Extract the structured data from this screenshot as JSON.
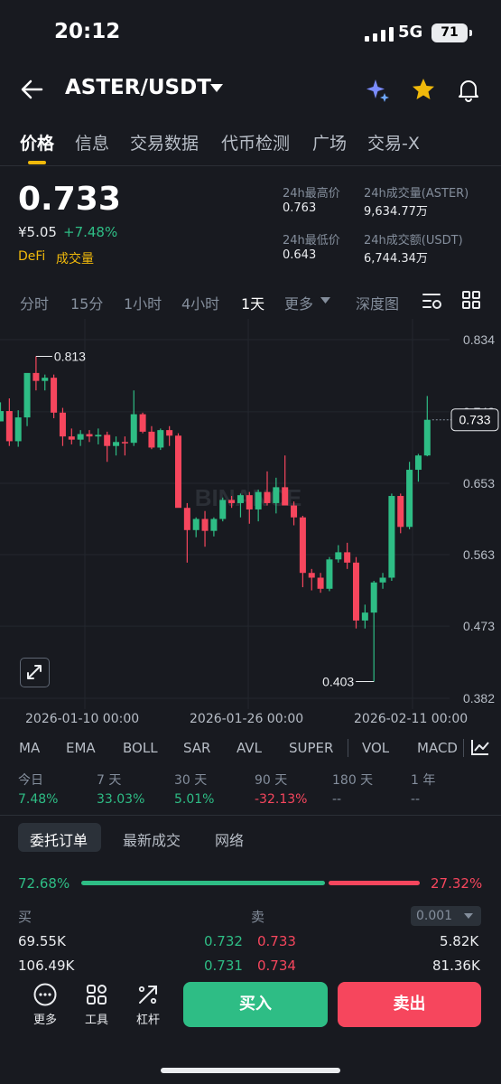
{
  "status_bar": {
    "time": "20:12",
    "network": "5G",
    "battery": "71"
  },
  "header": {
    "pair": "ASTER/USDT"
  },
  "tabs": [
    "价格",
    "信息",
    "交易数据",
    "代币检测",
    "广场",
    "交易-X"
  ],
  "price": {
    "last": "0.733",
    "cny": "¥5.05",
    "change": "+7.48%",
    "tag_sector": "DeFi",
    "tag_vol": "成交量"
  },
  "stats": {
    "high_label": "24h最高价",
    "high": "0.763",
    "vol_base_label": "24h成交量(ASTER)",
    "vol_base": "9,634.77万",
    "low_label": "24h最低价",
    "low": "0.643",
    "vol_quote_label": "24h成交额(USDT)",
    "vol_quote": "6,744.34万"
  },
  "intervals": [
    "分时",
    "15分",
    "1小时",
    "4小时",
    "1天",
    "更多",
    "深度图"
  ],
  "colors": {
    "up": "#2ebd85",
    "down": "#f6465d",
    "accent": "#f0b90b"
  },
  "chart_data": {
    "type": "candlestick",
    "watermark": "BINANCE",
    "y_ticks": [
      0.834,
      0.743,
      0.653,
      0.563,
      0.473,
      0.382
    ],
    "ylim": [
      0.382,
      0.834
    ],
    "x_labels": [
      "2026-01-10 00:00",
      "2026-01-26 00:00",
      "2026-02-11 00:00"
    ],
    "last_price": "0.733",
    "high_marker": "0.813",
    "low_marker": "0.403",
    "candles": [
      {
        "o": 0.731,
        "h": 0.755,
        "l": 0.731,
        "c": 0.744
      },
      {
        "o": 0.744,
        "h": 0.76,
        "l": 0.7,
        "c": 0.706
      },
      {
        "o": 0.706,
        "h": 0.745,
        "l": 0.699,
        "c": 0.736
      },
      {
        "o": 0.736,
        "h": 0.775,
        "l": 0.725,
        "c": 0.792
      },
      {
        "o": 0.792,
        "h": 0.813,
        "l": 0.77,
        "c": 0.782
      },
      {
        "o": 0.782,
        "h": 0.79,
        "l": 0.77,
        "c": 0.786
      },
      {
        "o": 0.786,
        "h": 0.79,
        "l": 0.735,
        "c": 0.742
      },
      {
        "o": 0.742,
        "h": 0.748,
        "l": 0.7,
        "c": 0.712
      },
      {
        "o": 0.712,
        "h": 0.722,
        "l": 0.702,
        "c": 0.708
      },
      {
        "o": 0.708,
        "h": 0.72,
        "l": 0.7,
        "c": 0.715
      },
      {
        "o": 0.715,
        "h": 0.72,
        "l": 0.705,
        "c": 0.712
      },
      {
        "o": 0.712,
        "h": 0.722,
        "l": 0.702,
        "c": 0.714
      },
      {
        "o": 0.714,
        "h": 0.718,
        "l": 0.68,
        "c": 0.7
      },
      {
        "o": 0.7,
        "h": 0.712,
        "l": 0.688,
        "c": 0.705
      },
      {
        "o": 0.705,
        "h": 0.712,
        "l": 0.688,
        "c": 0.704
      },
      {
        "o": 0.704,
        "h": 0.77,
        "l": 0.7,
        "c": 0.74
      },
      {
        "o": 0.74,
        "h": 0.742,
        "l": 0.716,
        "c": 0.718
      },
      {
        "o": 0.718,
        "h": 0.725,
        "l": 0.696,
        "c": 0.698
      },
      {
        "o": 0.698,
        "h": 0.722,
        "l": 0.695,
        "c": 0.72
      },
      {
        "o": 0.72,
        "h": 0.725,
        "l": 0.7,
        "c": 0.713
      },
      {
        "o": 0.713,
        "h": 0.716,
        "l": 0.64,
        "c": 0.622
      },
      {
        "o": 0.622,
        "h": 0.628,
        "l": 0.553,
        "c": 0.594
      },
      {
        "o": 0.594,
        "h": 0.61,
        "l": 0.585,
        "c": 0.608
      },
      {
        "o": 0.608,
        "h": 0.618,
        "l": 0.573,
        "c": 0.593
      },
      {
        "o": 0.593,
        "h": 0.61,
        "l": 0.586,
        "c": 0.608
      },
      {
        "o": 0.608,
        "h": 0.635,
        "l": 0.605,
        "c": 0.632
      },
      {
        "o": 0.632,
        "h": 0.637,
        "l": 0.622,
        "c": 0.628
      },
      {
        "o": 0.628,
        "h": 0.64,
        "l": 0.61,
        "c": 0.638
      },
      {
        "o": 0.638,
        "h": 0.642,
        "l": 0.602,
        "c": 0.62
      },
      {
        "o": 0.62,
        "h": 0.645,
        "l": 0.605,
        "c": 0.642
      },
      {
        "o": 0.642,
        "h": 0.668,
        "l": 0.625,
        "c": 0.628
      },
      {
        "o": 0.628,
        "h": 0.66,
        "l": 0.615,
        "c": 0.648
      },
      {
        "o": 0.648,
        "h": 0.688,
        "l": 0.635,
        "c": 0.625
      },
      {
        "o": 0.625,
        "h": 0.63,
        "l": 0.6,
        "c": 0.61
      },
      {
        "o": 0.61,
        "h": 0.612,
        "l": 0.522,
        "c": 0.54
      },
      {
        "o": 0.54,
        "h": 0.545,
        "l": 0.518,
        "c": 0.534
      },
      {
        "o": 0.534,
        "h": 0.54,
        "l": 0.515,
        "c": 0.52
      },
      {
        "o": 0.52,
        "h": 0.56,
        "l": 0.517,
        "c": 0.557
      },
      {
        "o": 0.557,
        "h": 0.575,
        "l": 0.553,
        "c": 0.566
      },
      {
        "o": 0.566,
        "h": 0.578,
        "l": 0.545,
        "c": 0.553
      },
      {
        "o": 0.553,
        "h": 0.56,
        "l": 0.47,
        "c": 0.48
      },
      {
        "o": 0.48,
        "h": 0.5,
        "l": 0.47,
        "c": 0.49
      },
      {
        "o": 0.49,
        "h": 0.53,
        "l": 0.403,
        "c": 0.528
      },
      {
        "o": 0.528,
        "h": 0.54,
        "l": 0.52,
        "c": 0.534
      },
      {
        "o": 0.534,
        "h": 0.64,
        "l": 0.53,
        "c": 0.637
      },
      {
        "o": 0.637,
        "h": 0.64,
        "l": 0.59,
        "c": 0.598
      },
      {
        "o": 0.598,
        "h": 0.68,
        "l": 0.595,
        "c": 0.67
      },
      {
        "o": 0.67,
        "h": 0.69,
        "l": 0.655,
        "c": 0.688
      },
      {
        "o": 0.688,
        "h": 0.763,
        "l": 0.687,
        "c": 0.733
      }
    ]
  },
  "indicators": [
    "MA",
    "EMA",
    "BOLL",
    "SAR",
    "AVL",
    "SUPER",
    "VOL",
    "MACD"
  ],
  "performance": [
    {
      "label": "今日",
      "value": "7.48%",
      "dir": "up"
    },
    {
      "label": "7 天",
      "value": "33.03%",
      "dir": "up"
    },
    {
      "label": "30 天",
      "value": "5.01%",
      "dir": "up"
    },
    {
      "label": "90 天",
      "value": "-32.13%",
      "dir": "down"
    },
    {
      "label": "180 天",
      "value": "--",
      "dir": "none"
    },
    {
      "label": "1 年",
      "value": "--",
      "dir": "none"
    }
  ],
  "orderbook": {
    "tabs": [
      "委托订单",
      "最新成交",
      "网络"
    ],
    "buy_pct": "72.68%",
    "sell_pct": "27.32%",
    "buy_header": "买",
    "sell_header": "卖",
    "precision": "0.001",
    "rows": [
      {
        "bid_qty": "69.55K",
        "bid": "0.732",
        "ask": "0.733",
        "ask_qty": "5.82K"
      },
      {
        "bid_qty": "106.49K",
        "bid": "0.731",
        "ask": "0.734",
        "ask_qty": "81.36K"
      }
    ]
  },
  "bottom": {
    "more": "更多",
    "tools": "工具",
    "leverage": "杠杆",
    "buy": "买入",
    "sell": "卖出"
  }
}
